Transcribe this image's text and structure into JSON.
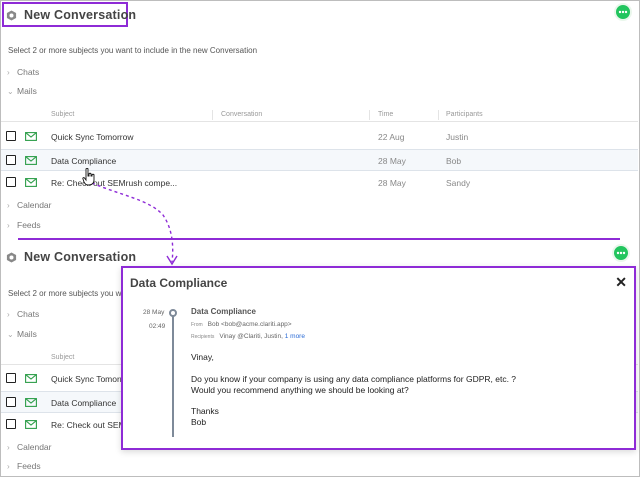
{
  "colors": {
    "accent": "#8e2bd6",
    "fab": "#22c55e",
    "link": "#2a6bd6",
    "mail_icon": "#2e9e4a"
  },
  "header": {
    "title": "New Conversation",
    "icon": "hexagon-icon",
    "chat_icon": "chat-bubble-icon"
  },
  "instructions_full": "Select 2 or more subjects you want to include in the new Conversation",
  "instructions_cut": "Select 2 or more subjects you w",
  "sections": {
    "chats": "Chats",
    "mails": "Mails",
    "calendar": "Calendar",
    "feeds": "Feeds"
  },
  "columns": {
    "subject": "Subject",
    "conversation": "Conversation",
    "time": "Time",
    "participants": "Participants"
  },
  "rows": [
    {
      "subject": "Quick Sync Tomorrow",
      "subject_cut": "Quick Sync Tomorro",
      "time": "22 Aug",
      "participants": "Justin"
    },
    {
      "subject": "Data Compliance",
      "subject_cut": "Data Compliance",
      "time": "28 May",
      "participants": "Bob"
    },
    {
      "subject": "Re: Check out SEMrush compe...",
      "subject_cut": "Re: Check out SEM",
      "time": "28 May",
      "participants": "Sandy"
    }
  ],
  "dialog": {
    "title": "Data Compliance",
    "close": "✕",
    "date": "28 May",
    "time": "02:49",
    "subject": "Data Compliance",
    "from_label": "From",
    "from": "Bob <bob@acme.clariti.app>",
    "recipients_label": "Recipients",
    "recipients": "Vinay @Clariti, Justin,",
    "more": "1 more",
    "body": [
      "Vinay,",
      "Do you know if your company is using any data compliance platforms for GDPR, etc. ?",
      "Would you recommend anything we should be looking at?",
      "Thanks",
      "Bob"
    ]
  }
}
